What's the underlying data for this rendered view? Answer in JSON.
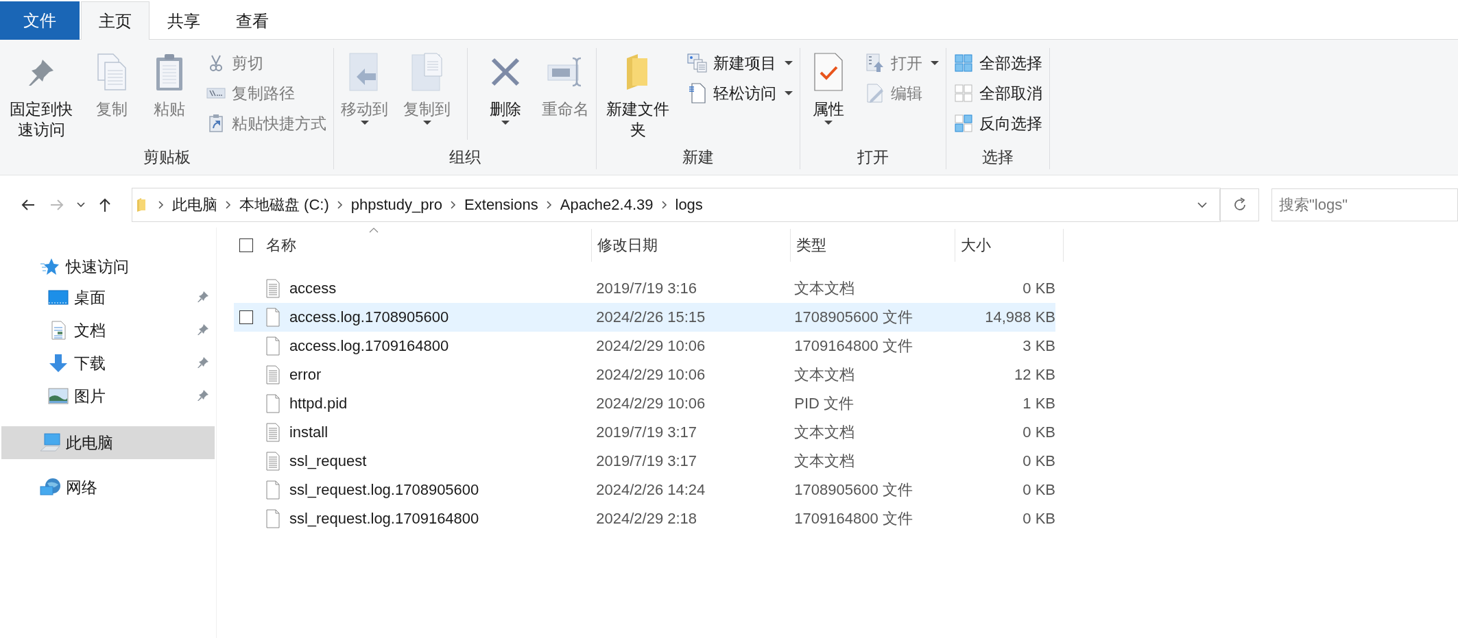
{
  "ribbon_tabs": [
    {
      "label": "文件",
      "kind": "menu",
      "selected": false
    },
    {
      "label": "主页",
      "kind": "tab",
      "selected": true
    },
    {
      "label": "共享",
      "kind": "tab",
      "selected": false
    },
    {
      "label": "查看",
      "kind": "tab",
      "selected": false
    }
  ],
  "ribbon_groups": [
    {
      "label": "剪贴板",
      "commands": [
        {
          "label": "固定到快速访问",
          "kind": "large",
          "disabled": false,
          "dropdown": false
        },
        {
          "label": "复制",
          "kind": "large",
          "disabled": true,
          "dropdown": false
        },
        {
          "label": "粘贴",
          "kind": "large",
          "disabled": true,
          "dropdown": false
        },
        {
          "kind": "stack",
          "items": [
            {
              "label": "剪切",
              "disabled": true,
              "dropdown": false
            },
            {
              "label": "复制路径",
              "disabled": true,
              "dropdown": false
            },
            {
              "label": "粘贴快捷方式",
              "disabled": true,
              "dropdown": false
            }
          ]
        }
      ]
    },
    {
      "label": "组织",
      "commands": [
        {
          "label": "移动到",
          "kind": "large",
          "disabled": true,
          "dropdown": true
        },
        {
          "label": "复制到",
          "kind": "large",
          "disabled": true,
          "dropdown": true
        },
        {
          "kind": "separator"
        },
        {
          "label": "删除",
          "kind": "large",
          "disabled": false,
          "dropdown": true
        },
        {
          "label": "重命名",
          "kind": "large",
          "disabled": true,
          "dropdown": false
        }
      ]
    },
    {
      "label": "新建",
      "commands": [
        {
          "label": "新建文件夹",
          "kind": "large",
          "disabled": false,
          "dropdown": false
        },
        {
          "kind": "stack",
          "items": [
            {
              "label": "新建项目",
              "disabled": false,
              "dropdown": true
            },
            {
              "label": "轻松访问",
              "disabled": false,
              "dropdown": true
            }
          ]
        }
      ]
    },
    {
      "label": "打开",
      "commands": [
        {
          "label": "属性",
          "kind": "large",
          "disabled": false,
          "dropdown": true
        },
        {
          "kind": "stack",
          "items": [
            {
              "label": "打开",
              "disabled": true,
              "dropdown": true
            },
            {
              "label": "编辑",
              "disabled": true,
              "dropdown": false
            }
          ]
        }
      ]
    },
    {
      "label": "选择",
      "commands": [
        {
          "kind": "stack",
          "items": [
            {
              "label": "全部选择",
              "disabled": false,
              "dropdown": false
            },
            {
              "label": "全部取消",
              "disabled": false,
              "dropdown": false
            },
            {
              "label": "反向选择",
              "disabled": false,
              "dropdown": false
            }
          ]
        }
      ]
    }
  ],
  "navigation": {
    "back": {
      "disabled": false
    },
    "forward": {
      "disabled": true
    }
  },
  "address_bar": {
    "breadcrumbs": [
      "此电脑",
      "本地磁盘 (C:)",
      "phpstudy_pro",
      "Extensions",
      "Apache2.4.39",
      "logs"
    ]
  },
  "search": {
    "placeholder": "搜索\"logs\""
  },
  "sidebar": {
    "items": [
      {
        "label": "快速访问",
        "selected": false,
        "children": [
          {
            "label": "桌面",
            "pinned": true,
            "selected": false
          },
          {
            "label": "文档",
            "pinned": true,
            "selected": false
          },
          {
            "label": "下载",
            "pinned": true,
            "selected": false
          },
          {
            "label": "图片",
            "pinned": true,
            "selected": false
          }
        ]
      },
      {
        "label": "此电脑",
        "selected": true
      },
      {
        "label": "网络",
        "selected": false
      }
    ]
  },
  "file_list": {
    "select_all": {
      "checked": false
    },
    "columns": [
      {
        "label": "名称",
        "sorted": true
      },
      {
        "label": "修改日期",
        "sorted": false
      },
      {
        "label": "类型",
        "sorted": false
      },
      {
        "label": "大小",
        "sorted": false
      }
    ],
    "rows": [
      {
        "name": "access",
        "kind": "text",
        "modified": "2019/7/19 3:16",
        "type": "文本文档",
        "size": "0 KB",
        "hovered": false
      },
      {
        "name": "access.log.1708905600",
        "kind": "blank",
        "modified": "2024/2/26 15:15",
        "type": "1708905600 文件",
        "size": "14,988 KB",
        "hovered": true
      },
      {
        "name": "access.log.1709164800",
        "kind": "blank",
        "modified": "2024/2/29 10:06",
        "type": "1709164800 文件",
        "size": "3 KB",
        "hovered": false
      },
      {
        "name": "error",
        "kind": "text",
        "modified": "2024/2/29 10:06",
        "type": "文本文档",
        "size": "12 KB",
        "hovered": false
      },
      {
        "name": "httpd.pid",
        "kind": "blank",
        "modified": "2024/2/29 10:06",
        "type": "PID 文件",
        "size": "1 KB",
        "hovered": false
      },
      {
        "name": "install",
        "kind": "text",
        "modified": "2019/7/19 3:17",
        "type": "文本文档",
        "size": "0 KB",
        "hovered": false
      },
      {
        "name": "ssl_request",
        "kind": "text",
        "modified": "2019/7/19 3:17",
        "type": "文本文档",
        "size": "0 KB",
        "hovered": false
      },
      {
        "name": "ssl_request.log.1708905600",
        "kind": "blank",
        "modified": "2024/2/26 14:24",
        "type": "1708905600 文件",
        "size": "0 KB",
        "hovered": false
      },
      {
        "name": "ssl_request.log.1709164800",
        "kind": "blank",
        "modified": "2024/2/29 2:18",
        "type": "1709164800 文件",
        "size": "0 KB",
        "hovered": false
      }
    ]
  }
}
